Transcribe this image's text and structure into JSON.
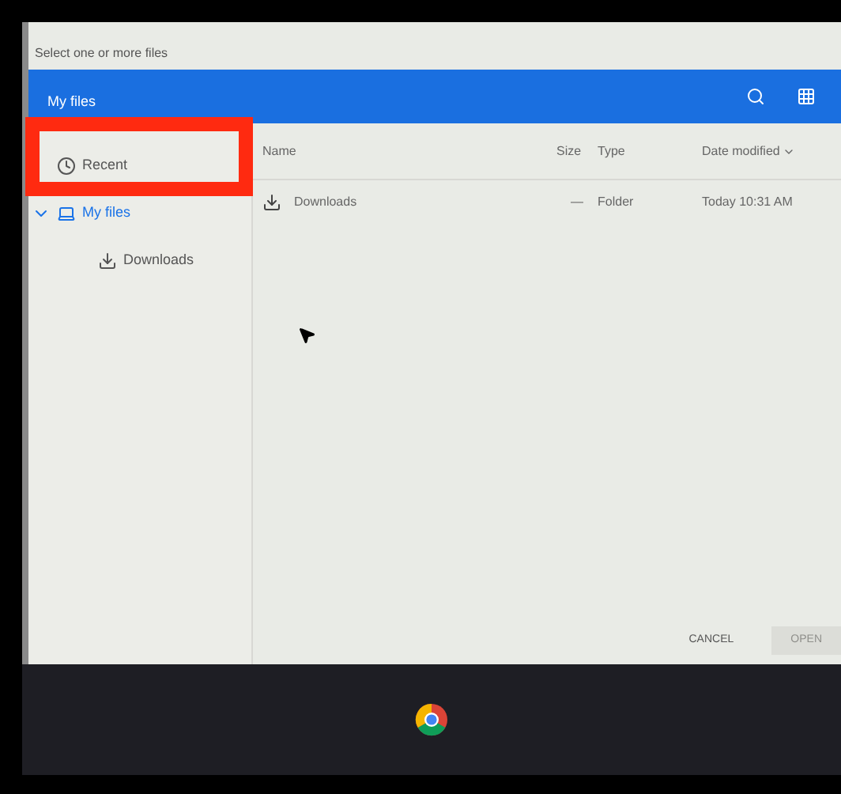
{
  "dialog": {
    "title": "Select one or more files",
    "header": {
      "title": "My files"
    },
    "sidebar": {
      "items": [
        {
          "label": "Recent",
          "kind": "recent",
          "selected": false,
          "annotated": true
        },
        {
          "label": "My files",
          "kind": "computer",
          "selected": true,
          "expanded": true,
          "annotated": false,
          "children": [
            {
              "label": "Downloads",
              "kind": "download",
              "selected": false,
              "annotated": false
            }
          ]
        }
      ]
    },
    "table": {
      "columns": [
        "Name",
        "Size",
        "Type",
        "Date modified"
      ],
      "rows": [
        {
          "name": "Downloads",
          "size": "—",
          "type": "Folder",
          "date": "Today 10:31 AM"
        }
      ]
    },
    "buttons": [
      {
        "label": "CANCEL",
        "disabled": false
      },
      {
        "label": "OPEN",
        "disabled": true
      }
    ]
  }
}
